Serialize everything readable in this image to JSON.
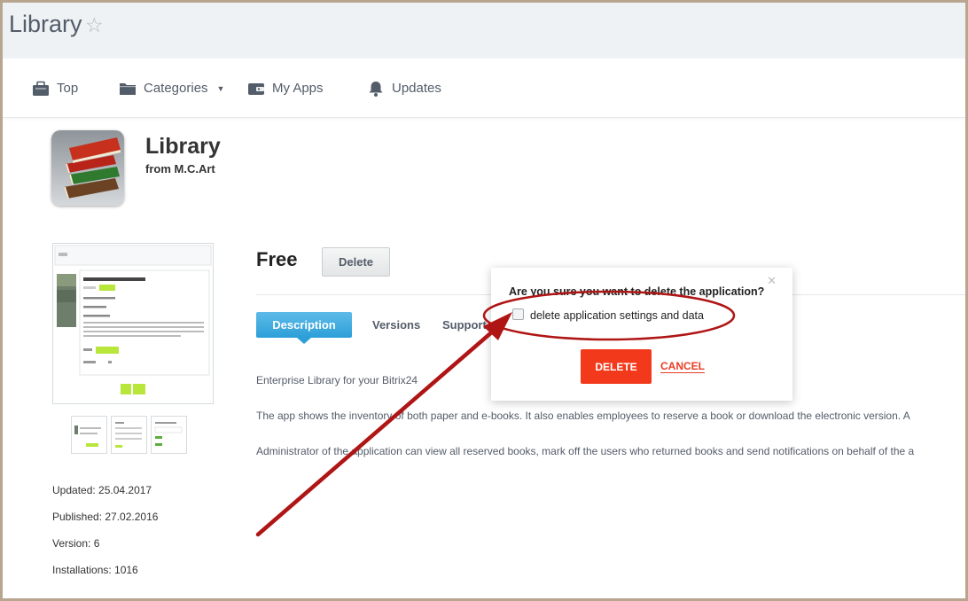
{
  "header": {
    "title": "Library"
  },
  "nav": {
    "items": [
      {
        "label": "Top"
      },
      {
        "label": "Categories"
      },
      {
        "label": "My Apps"
      },
      {
        "label": "Updates"
      }
    ]
  },
  "app": {
    "name": "Library",
    "author": "from M.C.Art",
    "price": "Free",
    "delete_label": "Delete"
  },
  "meta": {
    "updated": "Updated: 25.04.2017",
    "published": "Published: 27.02.2016",
    "version": "Version: 6",
    "installations": "Installations: 1016"
  },
  "tabs": [
    {
      "label": "Description",
      "active": true
    },
    {
      "label": "Versions"
    },
    {
      "label": "Support"
    }
  ],
  "description": {
    "line1": "Enterprise Library for your Bitrix24",
    "line2": "The app shows the inventory of both paper and e-books. It also enables employees to reserve a book or download the electronic version. A",
    "line3": "Administrator of the application can view all reserved books, mark off the users who returned books and send notifications on behalf of the a"
  },
  "popup": {
    "question": "Are you sure you want to delete the application?",
    "checkbox_label": "delete application settings and data",
    "checkbox_checked": false,
    "delete_label": "DELETE",
    "cancel_label": "CANCEL"
  },
  "colors": {
    "accent_blue": "#2c9fd8",
    "delete_red": "#f2391c",
    "annotation_red": "#b01515"
  }
}
